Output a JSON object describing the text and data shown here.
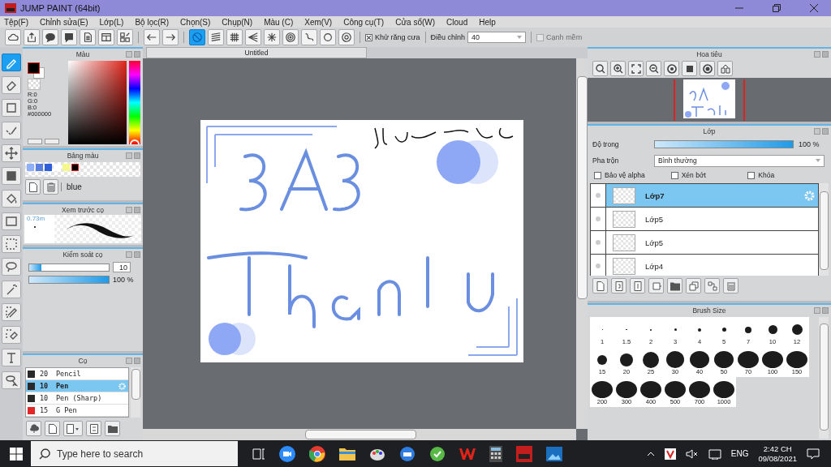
{
  "window": {
    "title": "JUMP PAINT (64bit)"
  },
  "menu": [
    "Tệp(F)",
    "Chỉnh sửa(E)",
    "Lớp(L)",
    "Bộ lọc(R)",
    "Chọn(S)",
    "Chụp(N)",
    "Màu (C)",
    "Xem(V)",
    "Công cụ(T)",
    "Cửa sổ(W)",
    "Cloud",
    "Help"
  ],
  "toolbar": {
    "buttons": [
      {
        "selected": false
      },
      {
        "selected": false
      },
      {
        "selected": false
      },
      {
        "selected": false
      },
      {
        "selected": false
      },
      {
        "selected": false
      },
      {
        "selected": false
      },
      {
        "selected": false
      },
      {
        "selected": false
      },
      {
        "selected": true
      },
      {
        "selected": false
      },
      {
        "selected": false
      },
      {
        "selected": false
      },
      {
        "selected": false
      },
      {
        "selected": false
      },
      {
        "selected": false
      },
      {
        "selected": false
      },
      {
        "selected": false
      }
    ],
    "antialias": {
      "label": "Khử răng cưa",
      "checked": true
    },
    "correction": {
      "label": "Điều chỉnh",
      "value": "40"
    },
    "soft_edge": {
      "label": "Cạnh mềm",
      "checked": false,
      "disabled": true
    }
  },
  "tools": [
    {
      "selected": true
    },
    {
      "selected": false
    },
    {
      "selected": false
    },
    {
      "selected": false
    },
    {
      "selected": false
    },
    {
      "selected": false
    },
    {
      "selected": false
    },
    {
      "selected": false
    },
    {
      "selected": false
    },
    {
      "selected": false
    },
    {
      "selected": false
    },
    {
      "selected": false
    },
    {
      "selected": false
    },
    {
      "selected": false
    },
    {
      "selected": false
    }
  ],
  "color_panel": {
    "title": "Màu",
    "hue": {
      "level": 1
    },
    "readouts": [
      "R:0",
      "G:0",
      "B:0",
      "#000000"
    ]
  },
  "palette": {
    "title": "Bảng màu",
    "name": "blue",
    "swatches": [
      {
        "color": "#8fb0f8",
        "selected": false
      },
      {
        "color": "#5a7ee0",
        "selected": false
      },
      {
        "color": "#2f5fd8",
        "selected": false
      },
      {
        "color": "#ffffff",
        "selected": false
      },
      {
        "color": "#f4f78a",
        "selected": false
      },
      {
        "color": "#000000",
        "selected": true
      }
    ]
  },
  "brush_preview": {
    "title": "Xem trước cọ",
    "size": "0.73m"
  },
  "brush_control": {
    "title": "Kiểm soát cọ",
    "size": {
      "level": 0.15,
      "value": "10"
    },
    "opacity": {
      "level": 1,
      "reading": "100 %"
    }
  },
  "brushes": {
    "title": "Cọ",
    "items": [
      {
        "color": "#2a2a2a",
        "size": "20",
        "name": "Pencil",
        "selected": false
      },
      {
        "color": "#2a2a2a",
        "size": "10",
        "name": "Pen",
        "selected": true
      },
      {
        "color": "#2a2a2a",
        "size": "10",
        "name": "Pen (Sharp)",
        "selected": false
      },
      {
        "color": "#e02828",
        "size": "15",
        "name": "G Pen",
        "selected": false
      }
    ]
  },
  "document_tab": "Untitled",
  "navigator": {
    "title": "Hoa tiêu"
  },
  "layers": {
    "title": "Lớp",
    "opacity_label": "Độ trong",
    "opacity": {
      "level": 1,
      "reading": "100 %"
    },
    "blend_label": "Pha trộn",
    "blend": "Bình thường",
    "options": [
      {
        "label": "Bảo vệ alpha",
        "checked": false
      },
      {
        "label": "Xén bớt",
        "checked": false
      },
      {
        "label": "Khóa",
        "checked": false
      }
    ],
    "items": [
      {
        "name": "Lớp7",
        "selected": true
      },
      {
        "name": "Lớp5",
        "selected": false
      },
      {
        "name": "Lớp5",
        "selected": false
      },
      {
        "name": "Lớp4",
        "selected": false
      }
    ]
  },
  "brush_size": {
    "title": "Brush Size",
    "sizes": [
      "1",
      "1.5",
      "2",
      "3",
      "4",
      "5",
      "7",
      "10",
      "12",
      "15",
      "20",
      "25",
      "30",
      "40",
      "50",
      "70",
      "100",
      "150",
      "200",
      "300",
      "400",
      "500",
      "700",
      "1000"
    ]
  },
  "taskbar": {
    "search_placeholder": "Type here to search",
    "language": "ENG",
    "time": "2:42 CH",
    "date": "09/08/2021"
  }
}
